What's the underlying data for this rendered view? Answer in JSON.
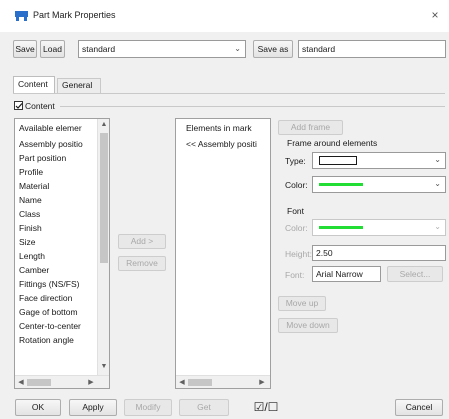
{
  "window": {
    "title": "Part Mark Properties",
    "close_glyph": "×"
  },
  "toolbar": {
    "save_label": "Save",
    "load_label": "Load",
    "preset_value": "standard",
    "save_as_label": "Save as",
    "save_as_value": "standard"
  },
  "tabs": [
    {
      "label": "Content",
      "active": true
    },
    {
      "label": "General",
      "active": false
    }
  ],
  "content_group": {
    "checkbox_label": "Content",
    "checked": true
  },
  "available_elements": {
    "items": [
      "Available elemer",
      "Assembly positio",
      "Part position",
      "Profile",
      "Material",
      "Name",
      "Class",
      "Finish",
      "Size",
      "Length",
      "Camber",
      "Fittings (NS/FS)",
      "Face direction",
      "Gage of bottom",
      "Center-to-center",
      "Rotation angle"
    ]
  },
  "middle_buttons": {
    "add_label": "Add >",
    "remove_label": "Remove"
  },
  "elements_in_mark": {
    "items": [
      "Elements in mark",
      "<< Assembly positi"
    ]
  },
  "right_panel": {
    "add_frame_label": "Add frame",
    "frame_title": "Frame around elements",
    "type_label": "Type:",
    "color_label": "Color:",
    "font_section_label": "Font",
    "font_color_label": "Color:",
    "height_label": "Height:",
    "height_value": "2.50",
    "font_label": "Font:",
    "font_value": "Arial Narrow",
    "select_label": "Select...",
    "move_up_label": "Move up",
    "move_down_label": "Move down",
    "accent_green": "#22dd33"
  },
  "footer": {
    "ok_label": "OK",
    "apply_label": "Apply",
    "modify_label": "Modify",
    "get_label": "Get",
    "toggle_label": "☑/☐",
    "cancel_label": "Cancel"
  }
}
